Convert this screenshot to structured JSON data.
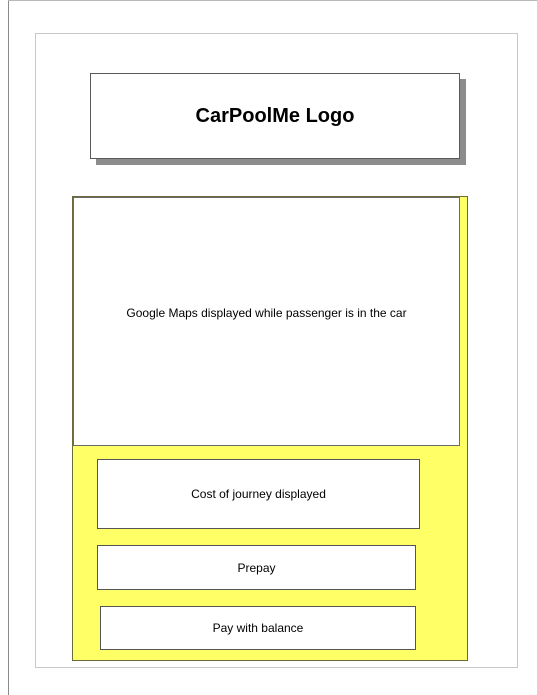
{
  "logo": {
    "text": "CarPoolMe Logo"
  },
  "map": {
    "text": "Google Maps displayed while passenger is in the car"
  },
  "cost": {
    "text": "Cost of journey displayed"
  },
  "buttons": {
    "prepay": "Prepay",
    "pay_with_balance": "Pay with balance"
  },
  "colors": {
    "panel": "#ffff66",
    "logo_shadow": "#8c8c8c"
  }
}
